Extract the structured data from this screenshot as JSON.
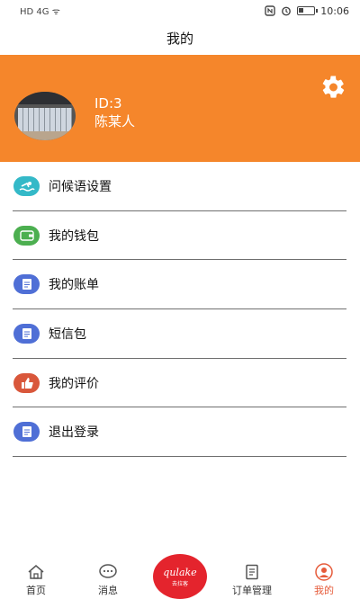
{
  "status_bar": {
    "left_indicators": "HD 4G ᯤ",
    "time": "10:06"
  },
  "header": {
    "title": "我的"
  },
  "profile": {
    "id": "ID:3",
    "name": "陈某人",
    "settings_icon": "gear-icon",
    "colors": {
      "background": "#f5862b"
    }
  },
  "menu": {
    "items": [
      {
        "label": "问候语设置",
        "icon": "swimmer-icon",
        "color": "#34b9c8"
      },
      {
        "label": "我的钱包",
        "icon": "wallet-icon",
        "color": "#4caf50"
      },
      {
        "label": "我的账单",
        "icon": "document-icon",
        "color": "#4f6fd6"
      },
      {
        "label": "短信包",
        "icon": "document-icon",
        "color": "#4f6fd6"
      },
      {
        "label": "我的评价",
        "icon": "thumbs-up-icon",
        "color": "#d9573b"
      },
      {
        "label": "退出登录",
        "icon": "document-icon",
        "color": "#4f6fd6"
      }
    ]
  },
  "tabbar": {
    "home_label": "首页",
    "messages_label": "消息",
    "center_brand": "qulake",
    "center_sub": "去拉客",
    "orders_label": "订单管理",
    "mine_label": "我的",
    "active_color": "#e65b3a",
    "center_color": "#e4242d"
  }
}
